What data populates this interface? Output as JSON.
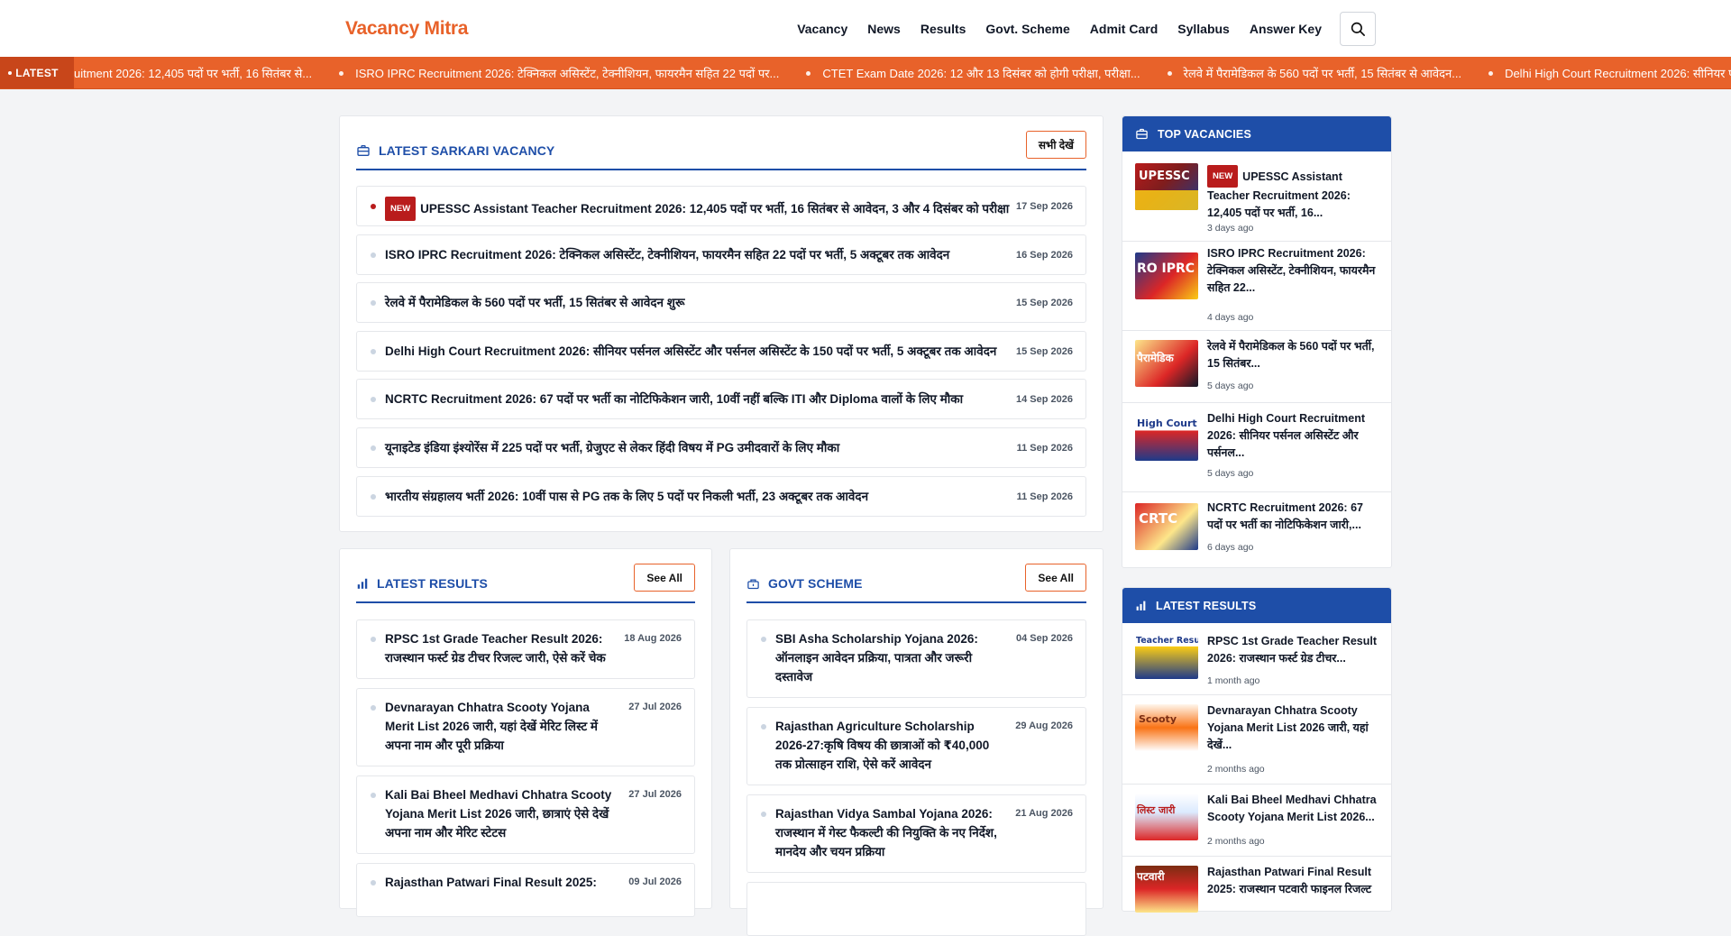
{
  "site": {
    "logo": "Vacancy Mitra"
  },
  "nav": [
    "Vacancy",
    "News",
    "Results",
    "Govt. Scheme",
    "Admit Card",
    "Syllabus",
    "Answer Key"
  ],
  "ticker": {
    "label": "LATEST",
    "items": [
      "uitment 2026: 12,405 पदों पर भर्ती, 16 सितंबर से...",
      "ISRO IPRC Recruitment 2026: टेक्निकल असिस्टेंट, टेक्नीशियन, फायरमैन सहित 22 पदों पर...",
      "CTET Exam Date 2026: 12 और 13 दिसंबर को होगी परीक्षा, परीक्षा...",
      "रेलवे में पैरामेडिकल के 560 पदों पर भर्ती, 15 सितंबर से आवेदन...",
      "Delhi High Court Recruitment 2026: सीनियर पर्सन"
    ]
  },
  "vacancy": {
    "title": "LATEST SARKARI VACANCY",
    "see_all": "सभी देखें",
    "badge": "NEW",
    "items": [
      {
        "title": "UPESSC Assistant Teacher Recruitment 2026: 12,405 पदों पर भर्ती, 16 सितंबर से आवेदन, 3 और 4 दिसंबर को परीक्षा",
        "date": "17 Sep 2026"
      },
      {
        "title": "ISRO IPRC Recruitment 2026: टेक्निकल असिस्टेंट, टेक्नीशियन, फायरमैन सहित 22 पदों पर भर्ती, 5 अक्टूबर तक आवेदन",
        "date": "16 Sep 2026"
      },
      {
        "title": "रेलवे में पैरामेडिकल के 560 पदों पर भर्ती, 15 सितंबर से आवेदन शुरू",
        "date": "15 Sep 2026"
      },
      {
        "title": "Delhi High Court Recruitment 2026: सीनियर पर्सनल असिस्टेंट और पर्सनल असिस्टेंट के 150 पदों पर भर्ती, 5 अक्टूबर तक आवेदन",
        "date": "15 Sep 2026"
      },
      {
        "title": "NCRTC Recruitment 2026: 67 पदों पर भर्ती का नोटिफिकेशन जारी, 10वीं नहीं बल्कि ITI और Diploma वालों के लिए मौका",
        "date": "14 Sep 2026"
      },
      {
        "title": "यूनाइटेड इंडिया इंश्योरेंस में 225 पदों पर भर्ती, ग्रेजुएट से लेकर हिंदी विषय में PG उमीदवारों के लिए मौका",
        "date": "11 Sep 2026"
      },
      {
        "title": "भारतीय संग्रहालय भर्ती 2026: 10वीं पास से PG तक के लिए 5 पदों पर निकली भर्ती, 23 अक्टूबर तक आवेदन",
        "date": "11 Sep 2026"
      }
    ]
  },
  "results": {
    "title": "LATEST RESULTS",
    "see_all": "See All",
    "items": [
      {
        "title": "RPSC 1st Grade Teacher Result 2026: राजस्थान फर्स्ट ग्रेड टीचर रिजल्ट जारी, ऐसे करें चेक",
        "date": "18 Aug 2026"
      },
      {
        "title": "Devnarayan Chhatra Scooty Yojana Merit List 2026 जारी, यहां देखें मेरिट लिस्ट में अपना नाम और पूरी प्रक्रिया",
        "date": "27 Jul 2026"
      },
      {
        "title": "Kali Bai Bheel Medhavi Chhatra Scooty Yojana Merit List 2026 जारी, छात्राएं ऐसे देखें अपना नाम और मेरिट स्टेटस",
        "date": "27 Jul 2026"
      },
      {
        "title": "Rajasthan Patwari Final Result 2025:",
        "date": "09 Jul 2026"
      }
    ]
  },
  "schemes": {
    "title": "GOVT SCHEME",
    "see_all": "See All",
    "items": [
      {
        "title": "SBI Asha Scholarship Yojana 2026: ऑनलाइन आवेदन प्रक्रिया, पात्रता और जरूरी दस्तावेज",
        "date": "04 Sep 2026"
      },
      {
        "title": "Rajasthan Agriculture Scholarship 2026-27:कृषि विषय की छात्राओं को ₹40,000 तक प्रोत्साहन राशि, ऐसे करें आवेदन",
        "date": "29 Aug 2026"
      },
      {
        "title": "Rajasthan Vidya Sambal Yojana 2026: राजस्थान में गेस्ट फैकल्टी की नियुक्ति के नए निर्देश, मानदेय और चयन प्रक्रिया",
        "date": "21 Aug 2026"
      }
    ]
  },
  "top_vacancies": {
    "title": "TOP VACANCIES",
    "badge": "NEW",
    "items": [
      {
        "title": "UPESSC Assistant Teacher Recruitment 2026: 12,405 पदों पर भर्ती, 16...",
        "ago": "3 days ago",
        "thumb": "UPESSC"
      },
      {
        "title": "ISRO IPRC Recruitment 2026: टेक्निकल असिस्टेंट, टेक्नीशियन, फायरमैन सहित 22...",
        "ago": "4 days ago",
        "thumb": "RO IPRC"
      },
      {
        "title": "रेलवे में पैरामेडिकल के 560 पदों पर भर्ती, 15 सितंबर...",
        "ago": "5 days ago",
        "thumb": "पैरामेडिक"
      },
      {
        "title": "Delhi High Court Recruitment 2026: सीनियर पर्सनल असिस्टेंट और पर्सनल...",
        "ago": "5 days ago",
        "thumb": "High Court"
      },
      {
        "title": "NCRTC Recruitment 2026: 67 पदों पर भर्ती का नोटिफिकेशन जारी,...",
        "ago": "6 days ago",
        "thumb": "CRTC"
      }
    ]
  },
  "side_results": {
    "title": "LATEST RESULTS",
    "items": [
      {
        "title": "RPSC 1st Grade Teacher Result 2026: राजस्थान फर्स्ट ग्रेड टीचर...",
        "ago": "1 month ago",
        "thumb": "Teacher Result"
      },
      {
        "title": "Devnarayan Chhatra Scooty Yojana Merit List 2026 जारी, यहां देखें...",
        "ago": "2 months ago",
        "thumb": "Scooty"
      },
      {
        "title": "Kali Bai Bheel Medhavi Chhatra Scooty Yojana Merit List 2026...",
        "ago": "2 months ago",
        "thumb": "लिस्ट जारी"
      },
      {
        "title": "Rajasthan Patwari Final Result 2025: राजस्थान पटवारी फाइनल रिजल्ट",
        "ago": "",
        "thumb": "पटवारी"
      }
    ]
  },
  "colors": {
    "accent": "#e8622a",
    "primary": "#1e4ea8",
    "badge": "#b91c1c"
  }
}
